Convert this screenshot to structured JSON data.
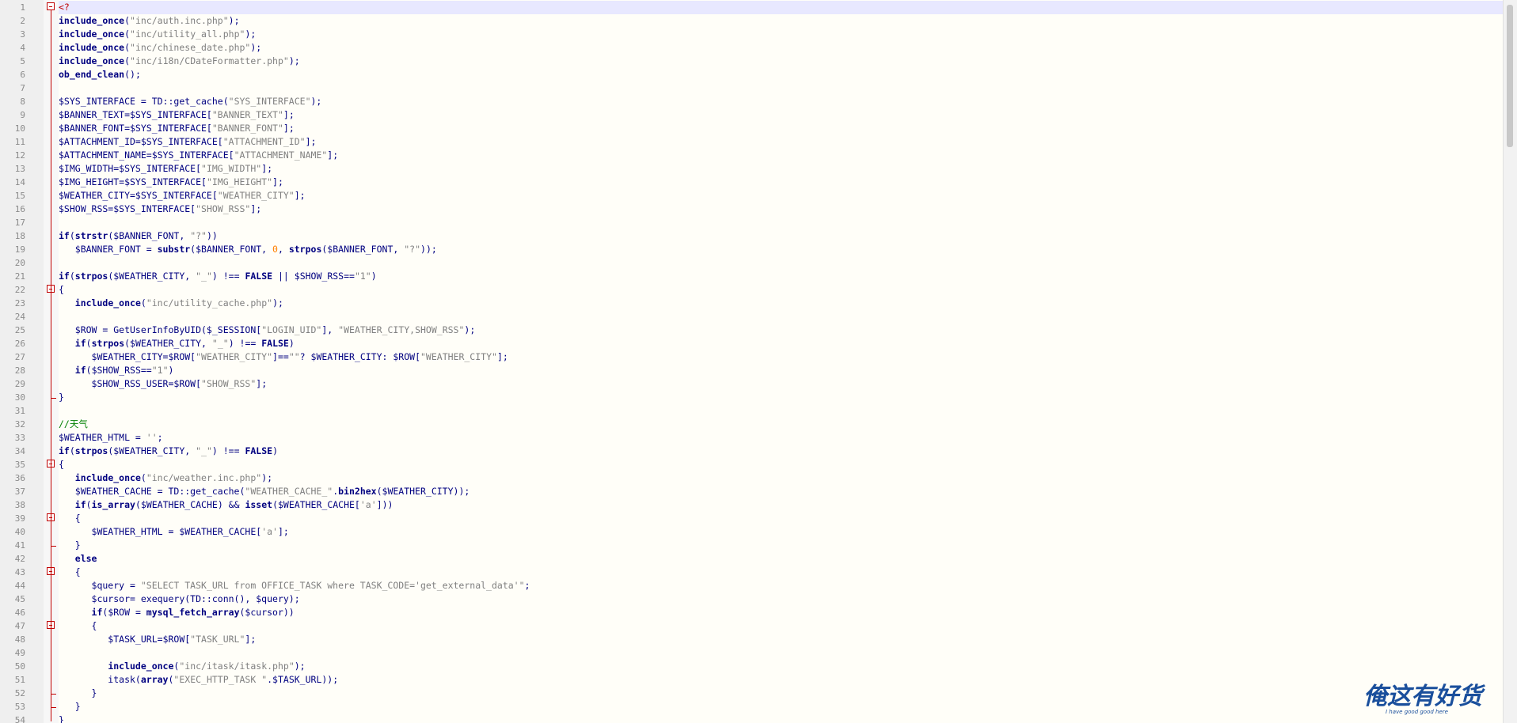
{
  "editor": {
    "lines": [
      {
        "n": "1",
        "text": "<?"
      },
      {
        "n": "2",
        "text": "include_once(\"inc/auth.inc.php\");"
      },
      {
        "n": "3",
        "text": "include_once(\"inc/utility_all.php\");"
      },
      {
        "n": "4",
        "text": "include_once(\"inc/chinese_date.php\");"
      },
      {
        "n": "5",
        "text": "include_once(\"inc/i18n/CDateFormatter.php\");"
      },
      {
        "n": "6",
        "text": "ob_end_clean();"
      },
      {
        "n": "7",
        "text": ""
      },
      {
        "n": "8",
        "text": "$SYS_INTERFACE = TD::get_cache(\"SYS_INTERFACE\");"
      },
      {
        "n": "9",
        "text": "$BANNER_TEXT=$SYS_INTERFACE[\"BANNER_TEXT\"];"
      },
      {
        "n": "10",
        "text": "$BANNER_FONT=$SYS_INTERFACE[\"BANNER_FONT\"];"
      },
      {
        "n": "11",
        "text": "$ATTACHMENT_ID=$SYS_INTERFACE[\"ATTACHMENT_ID\"];"
      },
      {
        "n": "12",
        "text": "$ATTACHMENT_NAME=$SYS_INTERFACE[\"ATTACHMENT_NAME\"];"
      },
      {
        "n": "13",
        "text": "$IMG_WIDTH=$SYS_INTERFACE[\"IMG_WIDTH\"];"
      },
      {
        "n": "14",
        "text": "$IMG_HEIGHT=$SYS_INTERFACE[\"IMG_HEIGHT\"];"
      },
      {
        "n": "15",
        "text": "$WEATHER_CITY=$SYS_INTERFACE[\"WEATHER_CITY\"];"
      },
      {
        "n": "16",
        "text": "$SHOW_RSS=$SYS_INTERFACE[\"SHOW_RSS\"];"
      },
      {
        "n": "17",
        "text": ""
      },
      {
        "n": "18",
        "text": "if(strstr($BANNER_FONT, \"?\"))"
      },
      {
        "n": "19",
        "text": "   $BANNER_FONT = substr($BANNER_FONT, 0, strpos($BANNER_FONT, \"?\"));"
      },
      {
        "n": "20",
        "text": ""
      },
      {
        "n": "21",
        "text": "if(strpos($WEATHER_CITY, \"_\") !== FALSE || $SHOW_RSS==\"1\")"
      },
      {
        "n": "22",
        "text": "{"
      },
      {
        "n": "23",
        "text": "   include_once(\"inc/utility_cache.php\");"
      },
      {
        "n": "24",
        "text": ""
      },
      {
        "n": "25",
        "text": "   $ROW = GetUserInfoByUID($_SESSION[\"LOGIN_UID\"], \"WEATHER_CITY,SHOW_RSS\");"
      },
      {
        "n": "26",
        "text": "   if(strpos($WEATHER_CITY, \"_\") !== FALSE)"
      },
      {
        "n": "27",
        "text": "      $WEATHER_CITY=$ROW[\"WEATHER_CITY\"]==\"\"? $WEATHER_CITY: $ROW[\"WEATHER_CITY\"];"
      },
      {
        "n": "28",
        "text": "   if($SHOW_RSS==\"1\")"
      },
      {
        "n": "29",
        "text": "      $SHOW_RSS_USER=$ROW[\"SHOW_RSS\"];"
      },
      {
        "n": "30",
        "text": "}"
      },
      {
        "n": "31",
        "text": ""
      },
      {
        "n": "32",
        "text": "//天气"
      },
      {
        "n": "33",
        "text": "$WEATHER_HTML = '';"
      },
      {
        "n": "34",
        "text": "if(strpos($WEATHER_CITY, \"_\") !== FALSE)"
      },
      {
        "n": "35",
        "text": "{"
      },
      {
        "n": "36",
        "text": "   include_once(\"inc/weather.inc.php\");"
      },
      {
        "n": "37",
        "text": "   $WEATHER_CACHE = TD::get_cache(\"WEATHER_CACHE_\".bin2hex($WEATHER_CITY));"
      },
      {
        "n": "38",
        "text": "   if(is_array($WEATHER_CACHE) && isset($WEATHER_CACHE['a']))"
      },
      {
        "n": "39",
        "text": "   {"
      },
      {
        "n": "40",
        "text": "      $WEATHER_HTML = $WEATHER_CACHE['a'];"
      },
      {
        "n": "41",
        "text": "   }"
      },
      {
        "n": "42",
        "text": "   else"
      },
      {
        "n": "43",
        "text": "   {"
      },
      {
        "n": "44",
        "text": "      $query = \"SELECT TASK_URL from OFFICE_TASK where TASK_CODE='get_external_data'\";"
      },
      {
        "n": "45",
        "text": "      $cursor= exequery(TD::conn(), $query);"
      },
      {
        "n": "46",
        "text": "      if($ROW = mysql_fetch_array($cursor))"
      },
      {
        "n": "47",
        "text": "      {"
      },
      {
        "n": "48",
        "text": "         $TASK_URL=$ROW[\"TASK_URL\"];"
      },
      {
        "n": "49",
        "text": ""
      },
      {
        "n": "50",
        "text": "         include_once(\"inc/itask/itask.php\");"
      },
      {
        "n": "51",
        "text": "         itask(array(\"EXEC_HTTP_TASK \".$TASK_URL));"
      },
      {
        "n": "52",
        "text": "      }"
      },
      {
        "n": "53",
        "text": "   }"
      },
      {
        "n": "54",
        "text": "}"
      }
    ],
    "fold_starts": [
      "1",
      "22",
      "35",
      "39",
      "43",
      "47"
    ],
    "fold_ends": [
      "30",
      "41",
      "52",
      "53"
    ]
  },
  "watermark": {
    "text": "俺这有好货",
    "subtext": "I have good good here",
    "color": "#1a4f9c"
  },
  "colors": {
    "background": "#fffef8",
    "keyword": "#000080",
    "string": "#808080",
    "comment": "#008000",
    "fold_marker": "#c00000"
  }
}
